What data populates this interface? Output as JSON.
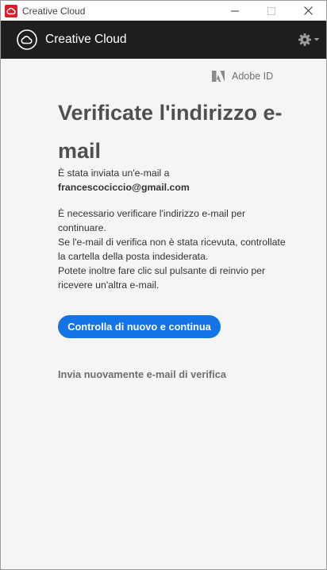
{
  "window": {
    "title": "Creative Cloud"
  },
  "header": {
    "brand": "Creative Cloud"
  },
  "adobe_id": {
    "label": "Adobe ID"
  },
  "main": {
    "title": "Verificate l'indirizzo e-mail",
    "sent_text": "È stata inviata un'e-mail a",
    "email": "francescociccio@gmail.com",
    "instruction_1": "È necessario verificare l'indirizzo e-mail per continuare.",
    "instruction_2": "Se l'e-mail di verifica non è stata ricevuta, controllate la cartella della posta indesiderata.",
    "instruction_3": "Potete inoltre fare clic sul pulsante di reinvio per ricevere un'altra e-mail.",
    "primary_button": "Controlla di nuovo e continua",
    "resend_link": "Invia nuovamente e-mail di verifica"
  },
  "colors": {
    "header_bg": "#1e1e1e",
    "accent": "#1473e6",
    "app_icon": "#da1f26"
  },
  "icons": [
    "creative-cloud-app-icon",
    "minimize-icon",
    "maximize-icon",
    "close-icon",
    "creative-cloud-logo-icon",
    "gear-icon",
    "chevron-down-icon",
    "adobe-logo-icon"
  ]
}
